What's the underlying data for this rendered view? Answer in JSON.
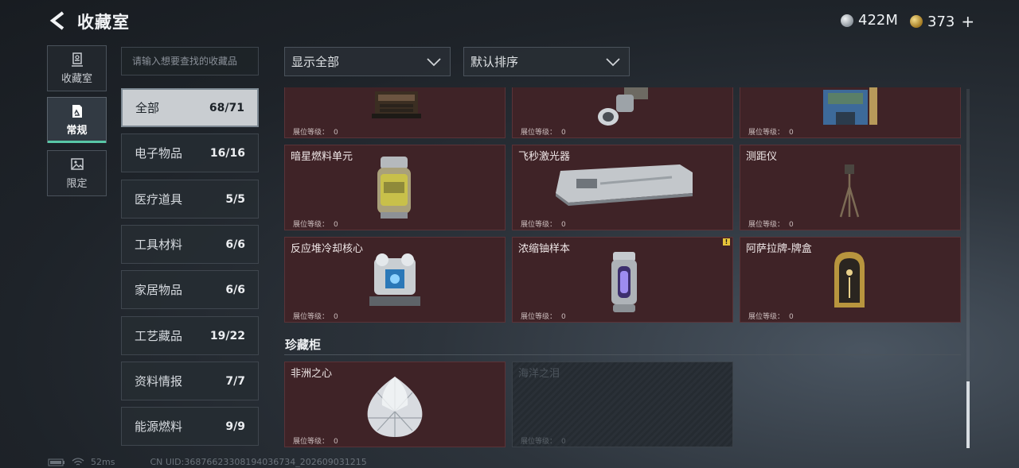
{
  "header": {
    "title": "收藏室",
    "currency_silver": "422M",
    "currency_gold": "373",
    "gold_plus": "+"
  },
  "side_tabs": [
    {
      "label": "收藏室",
      "icon": "vault-icon"
    },
    {
      "label": "常规",
      "icon": "document-icon"
    },
    {
      "label": "限定",
      "icon": "picture-icon"
    }
  ],
  "search": {
    "placeholder": "请输入想要查找的收藏品"
  },
  "categories": [
    {
      "label": "全部",
      "count": "68/71"
    },
    {
      "label": "电子物品",
      "count": "16/16"
    },
    {
      "label": "医疗道具",
      "count": "5/5"
    },
    {
      "label": "工具材料",
      "count": "6/6"
    },
    {
      "label": "家居物品",
      "count": "6/6"
    },
    {
      "label": "工艺藏品",
      "count": "19/22"
    },
    {
      "label": "资料情报",
      "count": "7/7"
    },
    {
      "label": "能源燃料",
      "count": "9/9"
    }
  ],
  "filters": {
    "show": "显示全部",
    "sort": "默认排序"
  },
  "level_label": "展位等级：",
  "items_row1": [
    {
      "name": "",
      "level": "0",
      "art": "typewriter"
    },
    {
      "name": "",
      "level": "0",
      "art": "laser-part"
    },
    {
      "name": "",
      "level": "0",
      "art": "machine-blue"
    }
  ],
  "items_row2": [
    {
      "name": "暗星燃料单元",
      "level": "0",
      "art": "fuel-canister"
    },
    {
      "name": "飞秒激光器",
      "level": "0",
      "art": "laser-box"
    },
    {
      "name": "测距仪",
      "level": "0",
      "art": "tripod"
    }
  ],
  "items_row3": [
    {
      "name": "反应堆冷却核心",
      "level": "0",
      "art": "reactor-core"
    },
    {
      "name": "浓缩铀样本",
      "level": "0",
      "art": "uranium-capsule",
      "badge": "!"
    },
    {
      "name": "阿萨拉牌-牌盒",
      "level": "0",
      "art": "card-box"
    }
  ],
  "treasure": {
    "title": "珍藏柜",
    "items": [
      {
        "name": "非洲之心",
        "level": "0",
        "art": "diamond",
        "locked": false
      },
      {
        "name": "海洋之泪",
        "level": "0",
        "art": "",
        "locked": true
      }
    ]
  },
  "footer": {
    "ping": "52ms",
    "uid": "CN UID:36876623308194036734_202609031215"
  }
}
